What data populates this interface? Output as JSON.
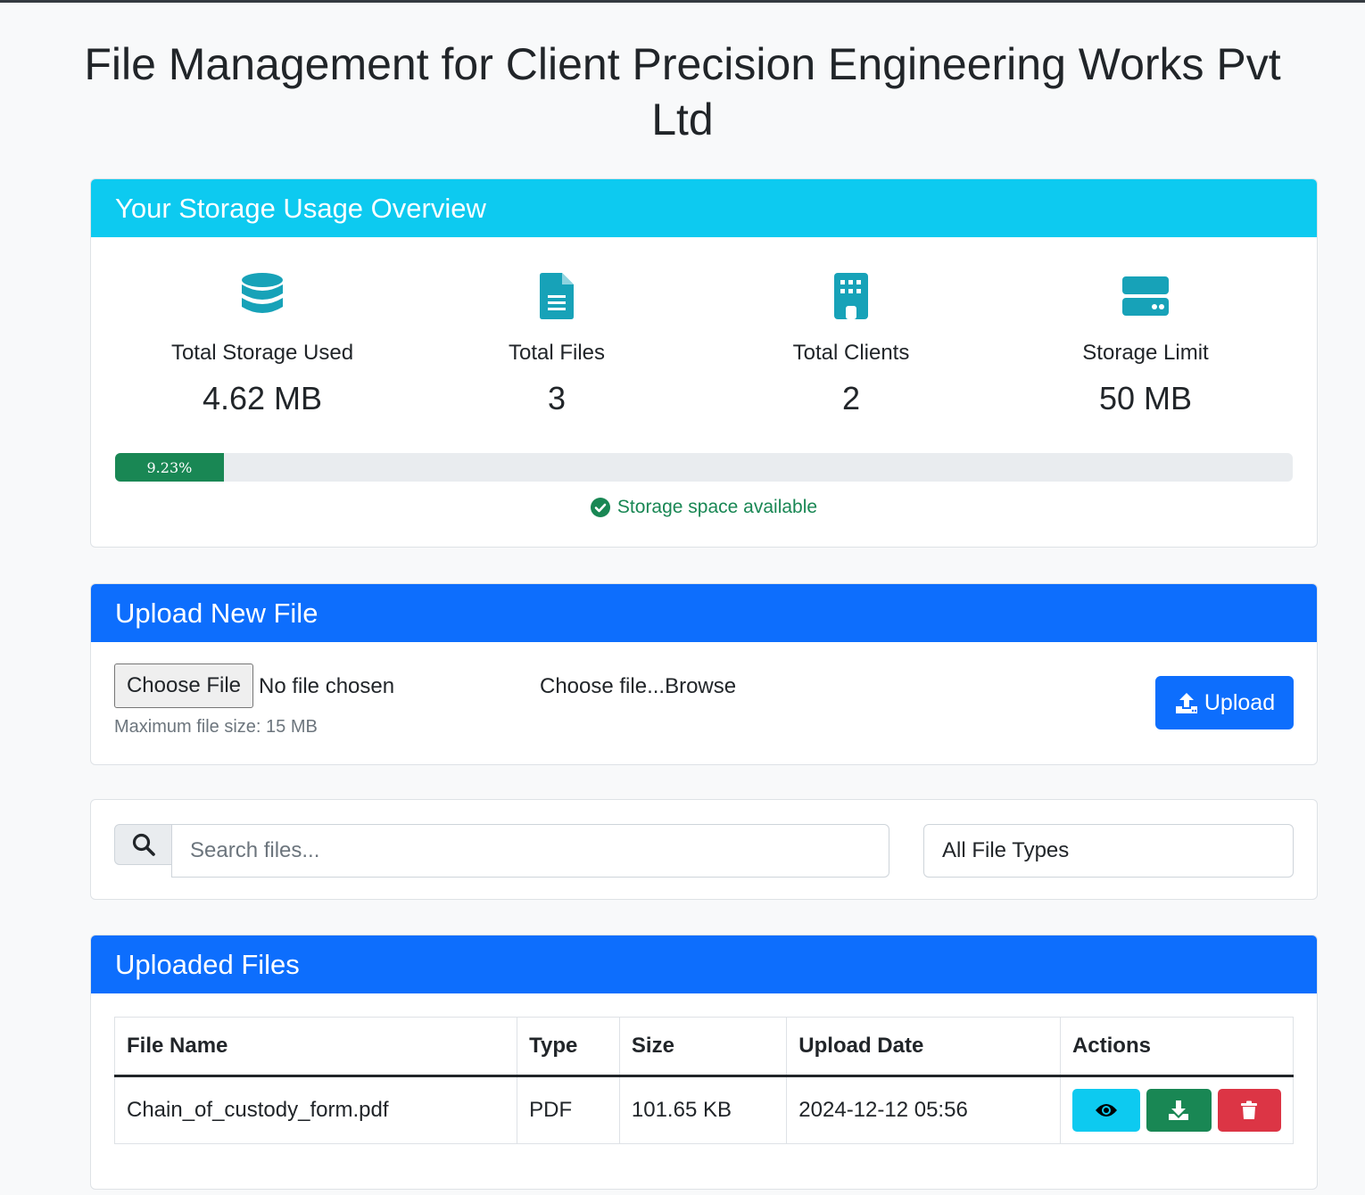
{
  "page": {
    "title": "File Management for Client Precision Engineering Works Pvt Ltd"
  },
  "storage": {
    "header": "Your Storage Usage Overview",
    "stats": [
      {
        "icon": "database-icon",
        "label": "Total Storage Used",
        "value": "4.62 MB"
      },
      {
        "icon": "file-icon",
        "label": "Total Files",
        "value": "3"
      },
      {
        "icon": "building-icon",
        "label": "Total Clients",
        "value": "2"
      },
      {
        "icon": "hdd-icon",
        "label": "Storage Limit",
        "value": "50 MB"
      }
    ],
    "progress_label": "9.23%",
    "progress_percent": 9.23,
    "status": "Storage space available",
    "colors": {
      "header": "#0dcaf0",
      "icon": "#17a2b8",
      "success": "#198754"
    }
  },
  "upload": {
    "header": "Upload New File",
    "choose_label": "Choose File",
    "no_file": "No file chosen",
    "browse_text": "Choose file...Browse",
    "max_size": "Maximum file size: 15 MB",
    "upload_label": "Upload",
    "color": "#0d6efd"
  },
  "search": {
    "placeholder": "Search files...",
    "type_filter": "All File Types"
  },
  "files": {
    "header": "Uploaded Files",
    "columns": [
      "File Name",
      "Type",
      "Size",
      "Upload Date",
      "Actions"
    ],
    "rows": [
      {
        "name": "Chain_of_custody_form.pdf",
        "type": "PDF",
        "size": "101.65 KB",
        "date": "2024-12-12 05:56"
      }
    ]
  }
}
